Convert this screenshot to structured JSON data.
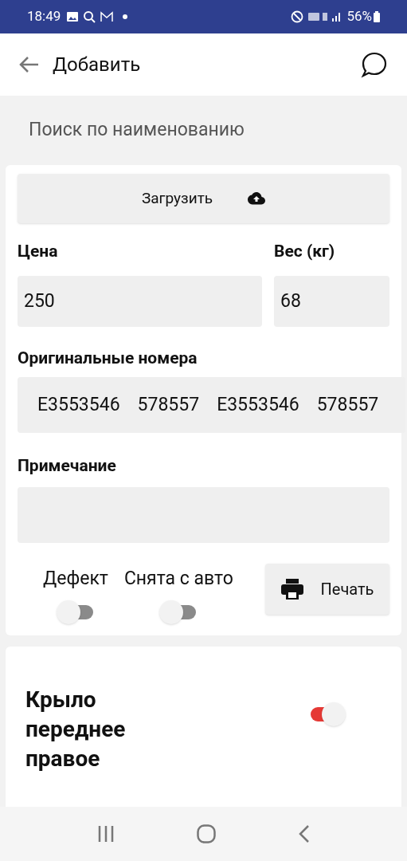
{
  "status_bar": {
    "time": "18:49",
    "battery": "56%"
  },
  "header": {
    "title": "Добавить"
  },
  "search": {
    "placeholder": "Поиск по наименованию"
  },
  "upload_button": {
    "label": "Загрузить"
  },
  "price": {
    "label": "Цена",
    "value": "250"
  },
  "weight": {
    "label": "Вес (кг)",
    "value": "68"
  },
  "original_numbers": {
    "label": "Оригинальные номера",
    "values": [
      "E3553546",
      "578557",
      "E3553546",
      "578557"
    ]
  },
  "note": {
    "label": "Примечание"
  },
  "switches": [
    {
      "label": "Дефект",
      "on": false
    },
    {
      "label": "Снята с авто",
      "on": false
    }
  ],
  "print_button": {
    "label": "Печать"
  },
  "part": {
    "title": "Крыло переднее правое",
    "on": true
  }
}
